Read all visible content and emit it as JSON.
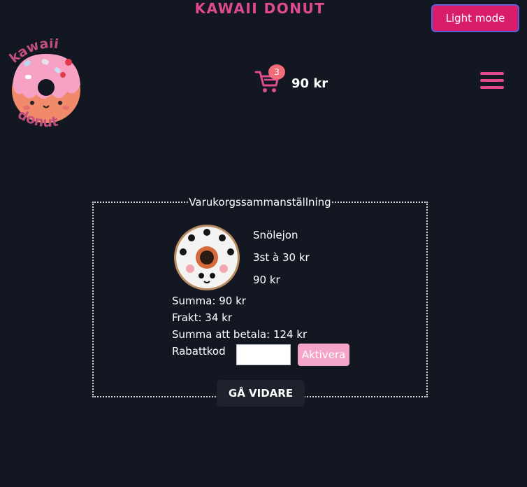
{
  "header": {
    "brand_title": "KAWAII DONUT",
    "theme_toggle_label": "Light mode",
    "logo_text_top": "kawaii",
    "logo_text_bottom": "donut"
  },
  "cart": {
    "item_count": "3",
    "total": "90 kr",
    "icon": "shopping-cart-icon"
  },
  "menu": {
    "icon": "hamburger-menu-icon"
  },
  "summary": {
    "legend": "Varukorgssammanställning",
    "product": {
      "name": "Snölejon",
      "quantity_price": "3st à 30 kr",
      "line_total": "90 kr"
    },
    "subtotal": "Summa: 90 kr",
    "shipping": "Frakt: 34 kr",
    "total_to_pay": "Summa att betala: 124 kr",
    "coupon_label": "Rabattkod",
    "coupon_value": "",
    "activate_label": "Aktivera",
    "continue_label": "GÅ VIDARE"
  },
  "colors": {
    "background": "#131722",
    "accent_pink": "#df4a91",
    "toggle_bg": "#d81e6b",
    "toggle_border": "#5860d8",
    "badge": "#f16d79",
    "activate_bg": "#f2a5c6",
    "continue_bg": "#1d222c"
  }
}
